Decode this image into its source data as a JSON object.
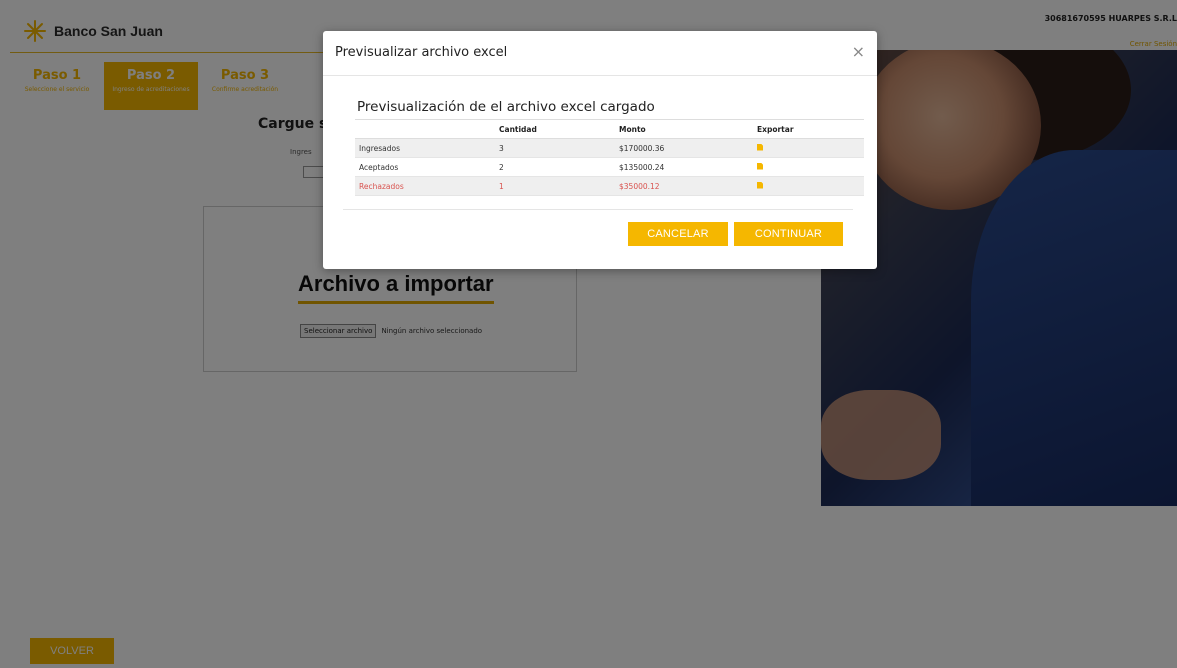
{
  "header": {
    "brand": "Banco San Juan",
    "user_cuit": "30681670595 HUARPES S.R.L",
    "logout": "Cerrar Sesión",
    "brand_color": "#f5b700"
  },
  "steps": [
    {
      "title": "Paso 1",
      "subtitle": "Seleccione el servicio",
      "active": false
    },
    {
      "title": "Paso 2",
      "subtitle": "Ingreso de acreditaciones",
      "active": true
    },
    {
      "title": "Paso 3",
      "subtitle": "Confirme acreditación",
      "active": false
    }
  ],
  "main": {
    "upload_heading": "Cargue su",
    "ingrese_label": "Ingres",
    "import_title": "Archivo a importar",
    "file_button": "Seleccionar archivo",
    "file_status": "Ningún archivo seleccionado",
    "back_button": "VOLVER"
  },
  "modal": {
    "title": "Previsualizar archivo excel",
    "close": "×",
    "heading": "Previsualización de el archivo excel cargado",
    "columns": [
      "",
      "Cantidad",
      "Monto",
      "Exportar"
    ],
    "rows": [
      {
        "label": "Ingresados",
        "cantidad": "3",
        "monto": "$170000.36"
      },
      {
        "label": "Aceptados",
        "cantidad": "2",
        "monto": "$135000.24"
      },
      {
        "label": "Rechazados",
        "cantidad": "1",
        "monto": "$35000.12"
      }
    ],
    "export_icon": "file-icon",
    "cancel": "CANCELAR",
    "continue": "CONTINUAR",
    "rejected_color": "#d9534f"
  }
}
